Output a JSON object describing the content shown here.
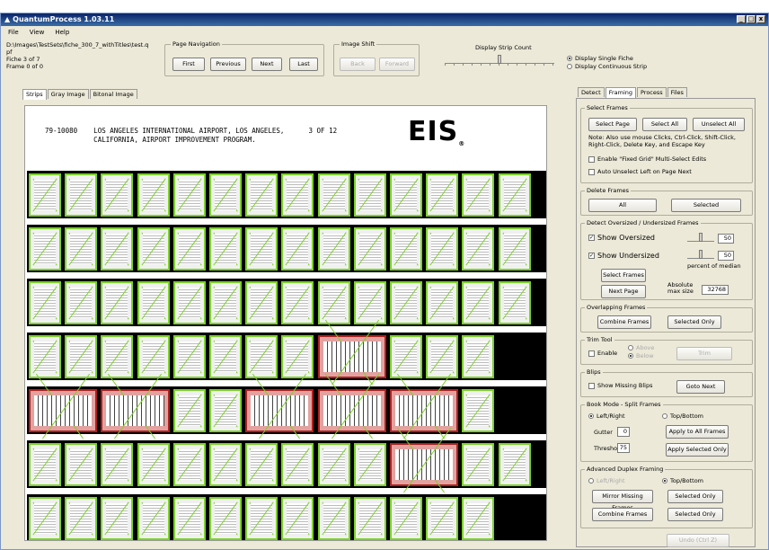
{
  "window": {
    "title": "QuantumProcess 1.03.11",
    "min": "_",
    "max": "□",
    "close": "x"
  },
  "menu": [
    "File",
    "View",
    "Help"
  ],
  "file": {
    "path": "D:\\Images\\TestSets\\fiche_300_7_withTitles\\test.qpf",
    "fiche": "Fiche 3 of 7",
    "frame": "Frame 0 of 0"
  },
  "page_nav": {
    "label": "Page Navigation",
    "first": "First",
    "previous": "Previous",
    "next": "Next",
    "last": "Last"
  },
  "image_shift": {
    "label": "Image Shift",
    "back": "Back",
    "forward": "Forward"
  },
  "strip_count": {
    "label": "Display Strip Count",
    "value": 0.5
  },
  "display_mode": {
    "single": "Display Single Fiche",
    "continuous": "Display Continuous Strip"
  },
  "viewer_tabs": [
    "Strips",
    "Gray Image",
    "Bitonal Image"
  ],
  "header": {
    "line1": "79-10080    LOS ANGELES INTERNATIONAL AIRPORT, LOS ANGELES,      3 OF 12",
    "line2": "            CALIFORNIA, AIRPORT IMPROVEMENT PROGRAM.",
    "logo": "EIS",
    "logo_sub": "®"
  },
  "panel_tabs": [
    "Detect",
    "Framing",
    "Process",
    "Files"
  ],
  "select_frames": {
    "label": "Select Frames",
    "select_page": "Select Page",
    "select_all": "Select All",
    "unselect_all": "Unselect All",
    "note": "Note: Also use mouse Clicks, Ctrl-Click, Shift-Click, Right-Click, Delete Key, and Escape Key",
    "fixed_grid": "Enable \"Fixed Grid\" Multi-Select Edits",
    "auto_unselect": "Auto Unselect Left on Page Next"
  },
  "delete_frames": {
    "label": "Delete Frames",
    "all": "All",
    "selected": "Selected"
  },
  "oversize": {
    "label": "Detect Oversized / Undersized Frames",
    "show_oversized": "Show Oversized",
    "oversized_value": "50",
    "show_undersized": "Show Undersized",
    "undersized_value": "50",
    "percent": "percent of median",
    "select_frames": "Select Frames",
    "next_page": "Next Page",
    "absolute": "Absolute",
    "max_size": "max size",
    "max_value": "32768"
  },
  "overlapping": {
    "label": "Overlapping Frames",
    "combine": "Combine Frames",
    "selected_only": "Selected Only"
  },
  "trim": {
    "label": "Trim Tool",
    "enable": "Enable",
    "above": "Above",
    "below": "Below",
    "trim": "Trim"
  },
  "blips": {
    "label": "Blips",
    "show_missing": "Show Missing Blips",
    "goto_next": "Goto Next"
  },
  "book_mode": {
    "label": "Book Mode - Split Frames",
    "left_right": "Left/Right",
    "top_bottom": "Top/Bottom",
    "gutter": "Gutter",
    "gutter_value": "0",
    "threshold": "Threshold",
    "threshold_value": "75",
    "apply_all": "Apply to All Frames",
    "apply_selected": "Apply Selected Only"
  },
  "duplex": {
    "label": "Advanced Duplex Framing",
    "left_right": "Left/Right",
    "top_bottom": "Top/Bottom",
    "mirror": "Mirror Missing Frames",
    "selected_only_1": "Selected Only",
    "combine": "Combine Frames",
    "selected_only_2": "Selected Only",
    "undo": "Undo (Ctrl Z)"
  },
  "strips": [
    [
      "g",
      "g",
      "g",
      "g",
      "g",
      "g",
      "g",
      "g",
      "g",
      "g",
      "g",
      "g",
      "g",
      "g"
    ],
    [
      "g",
      "g",
      "g",
      "g",
      "g",
      "g",
      "g",
      "g",
      "g",
      "g",
      "g",
      "g",
      "g",
      "g"
    ],
    [
      "g",
      "g",
      "g",
      "g",
      "g",
      "g",
      "g",
      "g",
      "g",
      "g",
      "g",
      "g",
      "g",
      "g"
    ],
    [
      "g",
      "g",
      "g",
      "g",
      "g",
      "g",
      "g",
      "g",
      "r",
      "g",
      "g",
      "g"
    ],
    [
      "r",
      "r",
      "g",
      "g",
      "r",
      "r",
      "r",
      "g"
    ],
    [
      "g",
      "g",
      "g",
      "g",
      "g",
      "g",
      "g",
      "g",
      "g",
      "g",
      "r",
      "g",
      "g"
    ],
    [
      "g",
      "g",
      "g",
      "g",
      "g",
      "g",
      "g",
      "g",
      "g",
      "g",
      "g",
      "g",
      "g"
    ]
  ]
}
